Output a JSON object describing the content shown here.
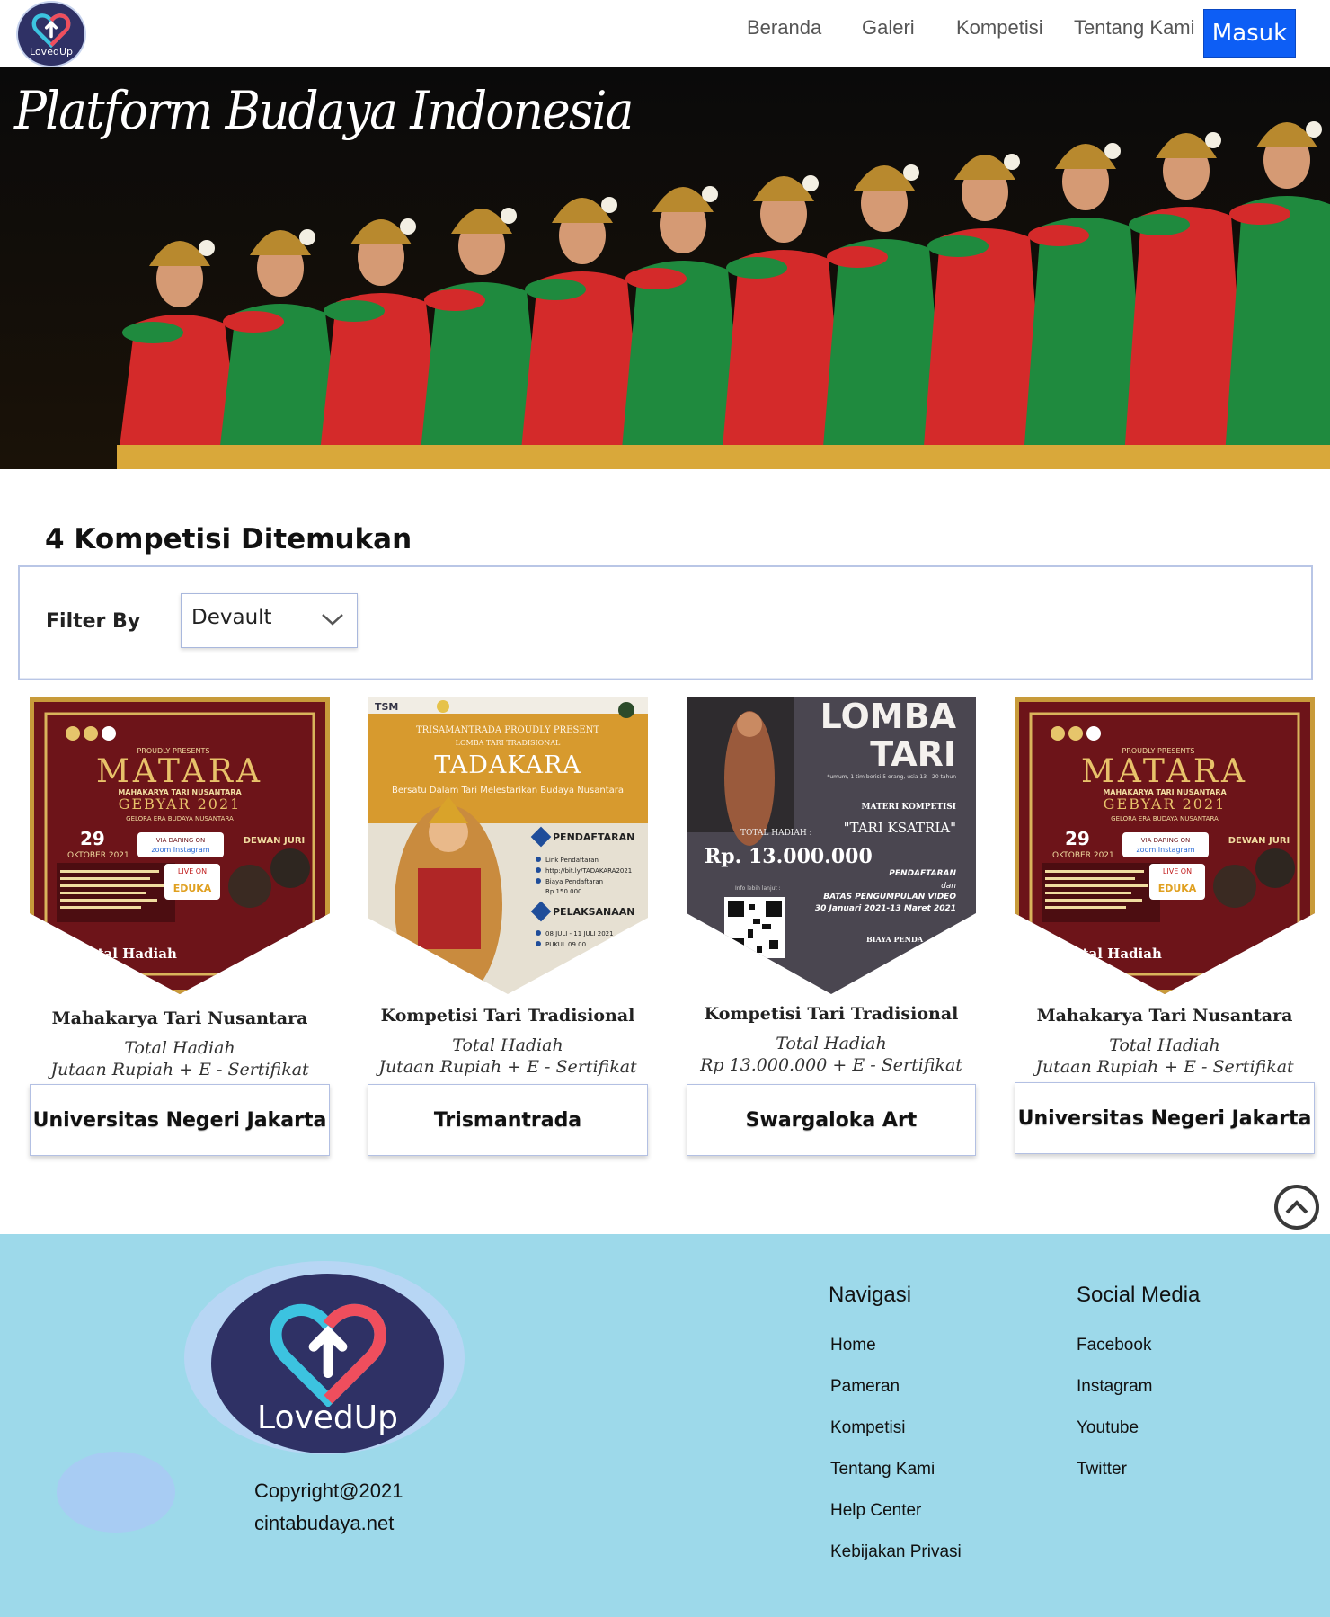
{
  "nav": {
    "logo_text": "LovedUp",
    "links": [
      "Beranda",
      "Galeri",
      "Kompetisi",
      "Tentang Kami"
    ],
    "login_label": "Masuk",
    "login_color": "#0d5ef5"
  },
  "hero": {
    "title": "Platform Budaya Indonesia"
  },
  "results": {
    "heading": "4 Kompetisi Ditemukan",
    "filter_label": "Filter By",
    "filter_value": "Devault"
  },
  "cards": [
    {
      "poster": {
        "title": "MATARA",
        "sub1": "MAHAKARYA TARI NUSANTARA",
        "sub2": "GEBYAR 2021",
        "sub3": "GELORA ERA BUDAYA NUSANTARA",
        "date": "29",
        "month": "OKTOBER 2021",
        "badge": "DEWAN JURI",
        "online": "VIA DARING ON",
        "apps": "zoom Instagram",
        "live": "LIVE ON",
        "live_src": "EDUKA",
        "prize": "Total Hadiah"
      },
      "title": "Mahakarya Tari Nusantara",
      "line1": "Total Hadiah",
      "line2": "Jutaan Rupiah + E - Sertifikat",
      "organizer": "Universitas Negeri Jakarta"
    },
    {
      "poster": {
        "top": "TSM",
        "present": "TRISAMANTRADA PROUDLY PRESENT",
        "kind": "LOMBA TARI TRADISIONAL",
        "title": "TADAKARA",
        "tagline": "Bersatu Dalam Tari Melestarikan Budaya Nusantara",
        "reg": "PENDAFTARAN",
        "reg_info": "Link Pendaftaran",
        "reg_link": "http://bit.ly/TADAKARA2021",
        "fee_label": "Biaya Pendaftaran",
        "fee": "Rp 150.000",
        "impl": "PELAKSANAAN",
        "impl_date": "08 JULI - 11 JULI 2021",
        "impl_time": "PUKUL 09.00"
      },
      "title": "Kompetisi Tari Tradisional",
      "line1": "Total Hadiah",
      "line2": "Jutaan Rupiah + E - Sertifikat",
      "organizer": "Trismantrada"
    },
    {
      "poster": {
        "title1": "LOMBA",
        "title2": "TARI",
        "note": "*umum, 1 tim berisi 5 orang, usia 13 - 20 tahun",
        "materi": "MATERI KOMPETISI",
        "materi_val": "\"TARI KSATRIA\"",
        "prize_label": "TOTAL HADIAH :",
        "prize": "Rp. 13.000.000",
        "reg": "PENDAFTARAN",
        "reg2": "dan",
        "reg3": "BATAS PENGUMPULAN VIDEO",
        "reg4": "30 Januari 2021-13 Maret 2021",
        "info": "Info lebih lanjut :",
        "fee": "BIAYA PENDA"
      },
      "title": "Kompetisi Tari Tradisional",
      "line1": "Total Hadiah",
      "line2": "Rp 13.000.000 + E - Sertifikat",
      "organizer": "Swargaloka Art"
    },
    {
      "poster": {
        "title": "MATARA",
        "sub1": "MAHAKARYA TARI NUSANTARA",
        "sub2": "GEBYAR 2021",
        "sub3": "GELORA ERA BUDAYA NUSANTARA",
        "date": "29",
        "month": "OKTOBER 2021",
        "badge": "DEWAN JURI",
        "online": "VIA DARING ON",
        "apps": "zoom Instagram",
        "live": "LIVE ON",
        "live_src": "EDUKA",
        "prize": "Total Hadiah"
      },
      "title": "Mahakarya Tari Nusantara",
      "line1": "Total Hadiah",
      "line2": "Jutaan Rupiah + E - Sertifikat",
      "organizer": "Universitas Negeri Jakarta"
    }
  ],
  "footer": {
    "logo_text": "LovedUp",
    "copyright": "Copyright@2021",
    "site": "cintabudaya.net",
    "nav_title": "Navigasi",
    "nav_links": [
      "Home",
      "Pameran",
      "Kompetisi",
      "Tentang Kami",
      "Help Center",
      "Kebijakan Privasi"
    ],
    "social_title": "Social Media",
    "social_links": [
      "Facebook",
      "Instagram",
      "Youtube",
      "Twitter"
    ],
    "bg_color": "#9dd9ea"
  }
}
